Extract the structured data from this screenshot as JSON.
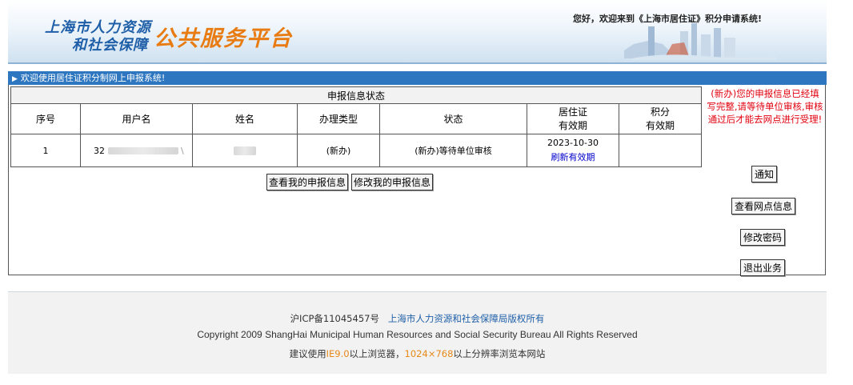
{
  "header": {
    "logo_line1": "上海市人力资源",
    "logo_line2": "和社会保障",
    "logo_big": "公共服务平台",
    "welcome": "您好，欢迎来到《上海市居住证》积分申请系统!"
  },
  "bluebar": {
    "arrow": "▶",
    "text": "欢迎使用居住证积分制网上申报系统!"
  },
  "table": {
    "caption": "申报信息状态",
    "headers": {
      "index": "序号",
      "username": "用户名",
      "name": "姓名",
      "type": "办理类型",
      "status": "状态",
      "residence_line1": "居住证",
      "residence_line2": "有效期",
      "points_line1": "积分",
      "points_line2": "有效期"
    },
    "row": {
      "index": "1",
      "username_prefix": "32",
      "username_suffix": "\\",
      "type": "(新办)",
      "status": "(新办)等待单位审核",
      "residence_date": "2023-10-30",
      "refresh_link": "刷新有效期",
      "points_validity": ""
    }
  },
  "buttons": {
    "view_info": "查看我的申报信息",
    "modify_info": "修改我的申报信息"
  },
  "side": {
    "notice": "(新办)您的申报信息已经填写完整,请等待单位审核,审核通过后才能去网点进行受理!",
    "notify": "通知",
    "view_outlets": "查看网点信息",
    "change_password": "修改密码",
    "logout": "退出业务"
  },
  "footer": {
    "icp": "沪ICP备11045457号",
    "rights": "上海市人力资源和社会保障局版权所有",
    "copyright": "Copyright 2009 ShangHai Municipal Human Resources and Social Security Bureau All Rights Reserved",
    "suggest_prefix": "建议使用",
    "suggest_browser": "IE9.0",
    "suggest_mid": "以上浏览器，",
    "suggest_resolution": "1024×768",
    "suggest_suffix": "以上分辨率浏览本网站"
  },
  "colors": {
    "bluebar": "#2e77c0",
    "logo_blue": "#1f5fa8",
    "logo_orange": "#e87b12",
    "notice_red": "#e0000e",
    "link_blue": "#0000cc"
  }
}
